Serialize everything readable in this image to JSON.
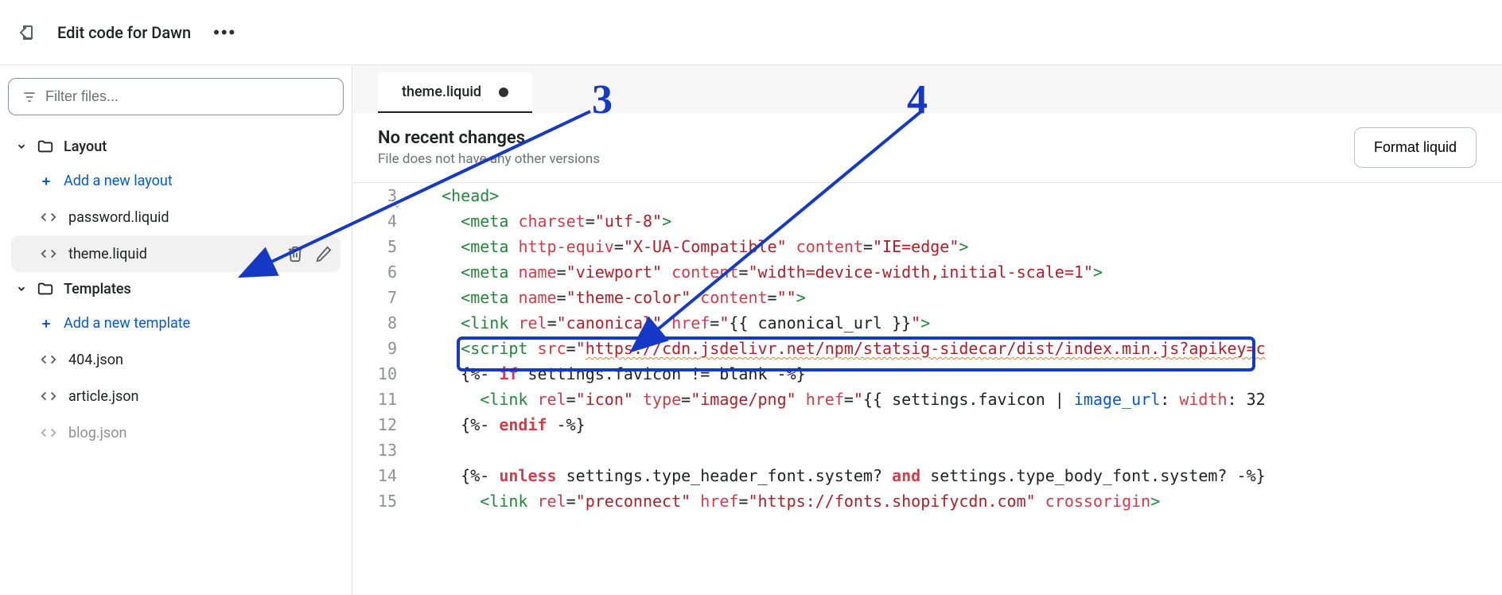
{
  "header": {
    "title": "Edit code for Dawn"
  },
  "sidebar": {
    "filter_placeholder": "Filter files...",
    "sections": {
      "layout": {
        "label": "Layout",
        "add_label": "Add a new layout",
        "files": [
          {
            "name": "password.liquid",
            "active": false
          },
          {
            "name": "theme.liquid",
            "active": true
          }
        ]
      },
      "templates": {
        "label": "Templates",
        "add_label": "Add a new template",
        "files": [
          {
            "name": "404.json"
          },
          {
            "name": "article.json"
          },
          {
            "name": "blog.json"
          }
        ]
      }
    }
  },
  "editor": {
    "tab": {
      "label": "theme.liquid",
      "dirty": true
    },
    "status": {
      "title": "No recent changes",
      "subtitle": "File does not have any other versions"
    },
    "format_button": "Format liquid",
    "line_numbers": [
      3,
      4,
      5,
      6,
      7,
      8,
      9,
      10,
      11,
      12,
      13,
      14,
      15
    ],
    "code_lines_text": [
      "  <head>",
      "    <meta charset=\"utf-8\">",
      "    <meta http-equiv=\"X-UA-Compatible\" content=\"IE=edge\">",
      "    <meta name=\"viewport\" content=\"width=device-width,initial-scale=1\">",
      "    <meta name=\"theme-color\" content=\"\">",
      "    <link rel=\"canonical\" href=\"{{ canonical_url }}\">",
      "    <script src=\"https://cdn.jsdelivr.net/npm/statsig-sidecar/dist/index.min.js?apikey=c",
      "    {%- if settings.favicon != blank -%}",
      "      <link rel=\"icon\" type=\"image/png\" href=\"{{ settings.favicon | image_url: width: 32",
      "    {%- endif -%}",
      "",
      "    {%- unless settings.type_header_font.system? and settings.type_body_font.system? -%}",
      "      <link rel=\"preconnect\" href=\"https://fonts.shopifycdn.com\" crossorigin>"
    ]
  },
  "annotations": {
    "num3": "3",
    "num4": "4"
  }
}
